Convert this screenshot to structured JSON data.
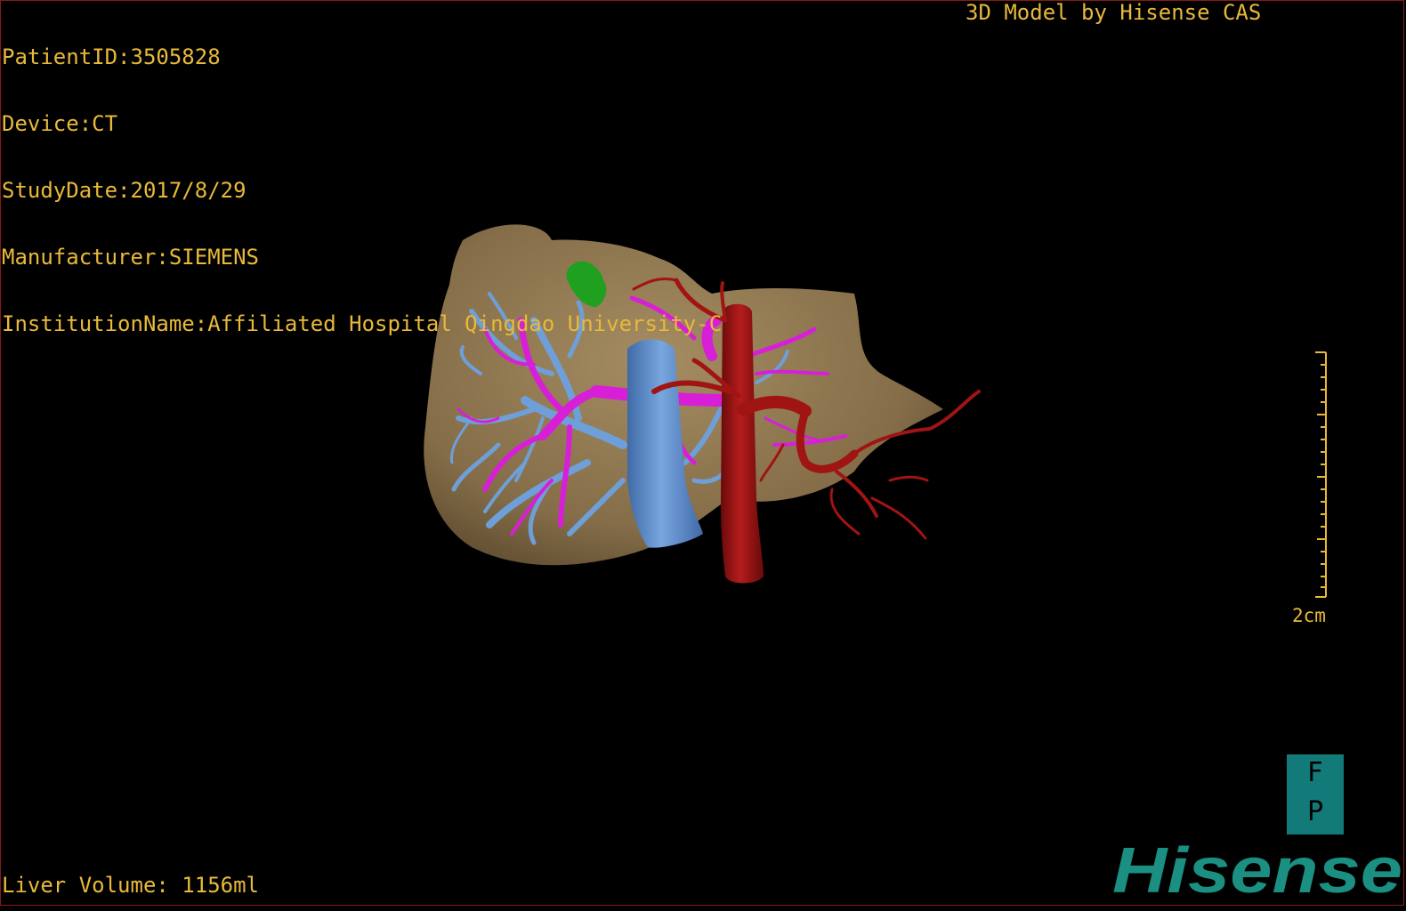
{
  "header": {
    "patient_id": "PatientID:3505828",
    "device": "Device:CT",
    "study_date": "StudyDate:2017/8/29",
    "manufacturer": "Manufacturer:SIEMENS",
    "institution": "InstitutionName:Affiliated Hospital Qingdao University-C",
    "credit": "3D Model by Hisense CAS"
  },
  "footer": {
    "liver_volume": "Liver Volume: 1156ml"
  },
  "scale": {
    "label": "2cm"
  },
  "orientation": {
    "top": "F",
    "bottom": "P"
  },
  "brand": {
    "logo_text": "Hisense",
    "logo_color": "#1a8f82"
  },
  "colors": {
    "text": "#e8b93a",
    "liver": "#8b7550",
    "hepatic_vein": "#6f9fd8",
    "portal_vein": "#d81fd8",
    "artery": "#a01414",
    "ivc": "#5f8cc8",
    "lesion": "#1fa01f",
    "frame": "#8a1a1a"
  }
}
